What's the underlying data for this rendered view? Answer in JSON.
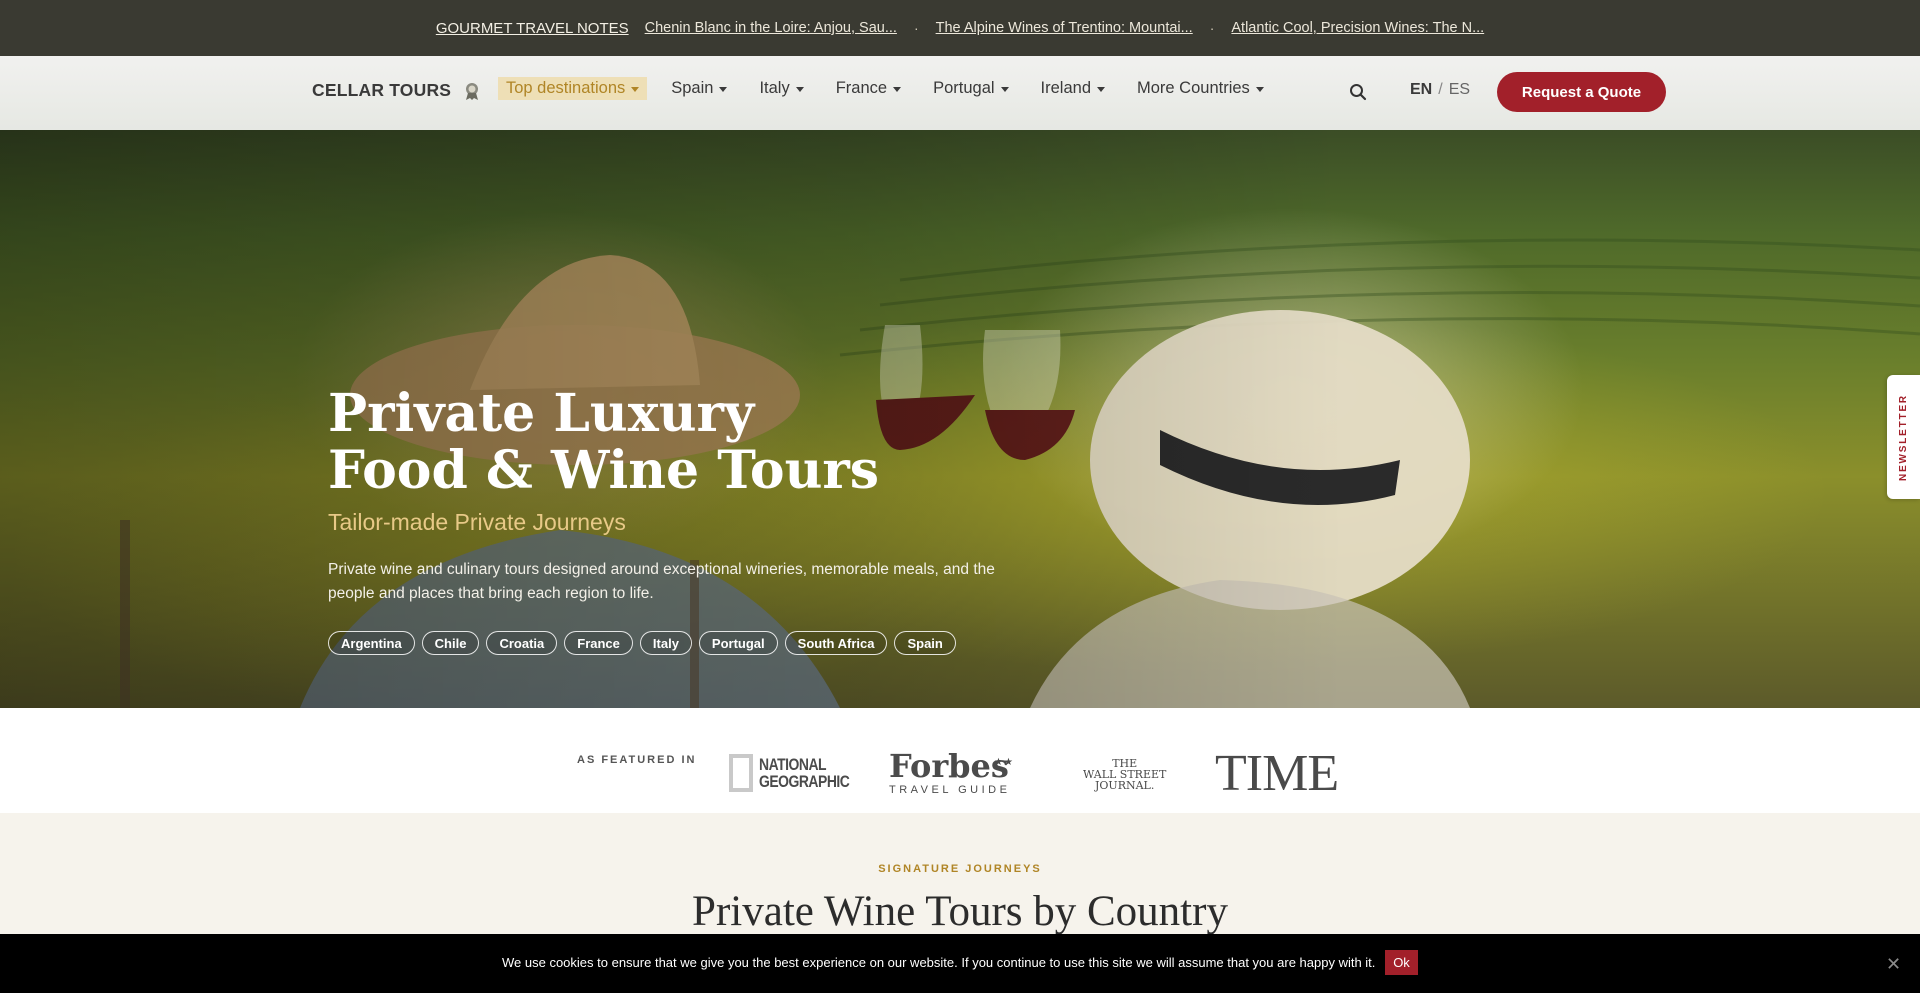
{
  "notes_bar": {
    "title": "GOURMET TRAVEL NOTES",
    "links": [
      "Chenin Blanc in the Loire: Anjou, Sau...",
      "The Alpine Wines of Trentino: Mountai...",
      "Atlantic Cool, Precision Wines: The N..."
    ],
    "separator": "·"
  },
  "nav": {
    "brand": "CELLAR TOURS",
    "award_icon": "award-badge-icon",
    "items": [
      {
        "label": "Top destinations",
        "highlighted": true
      },
      {
        "label": "Spain"
      },
      {
        "label": "Italy"
      },
      {
        "label": "France"
      },
      {
        "label": "Portugal"
      },
      {
        "label": "Ireland"
      },
      {
        "label": "More Countries"
      }
    ],
    "search_icon": "search-icon",
    "lang_en": "EN",
    "lang_sep": "/",
    "lang_es": "ES",
    "quote_button": "Request a Quote"
  },
  "hero": {
    "title_line1": "Private Luxury",
    "title_line2": "Food & Wine Tours",
    "subtitle": "Tailor-made Private Journeys",
    "description": "Private wine and culinary tours designed around exceptional wineries, memorable meals, and the people and places that bring each region to life.",
    "countries": [
      "Argentina",
      "Chile",
      "Croatia",
      "France",
      "Italy",
      "Portugal",
      "South Africa",
      "Spain"
    ]
  },
  "newsletter_tab": "NEWSLETTER",
  "featured": {
    "label": "AS FEATURED IN",
    "natgeo_line1": "NATIONAL",
    "natgeo_line2": "GEOGRAPHIC",
    "forbes_big": "Forbes",
    "forbes_stars": "★★",
    "forbes_small": "TRAVEL GUIDE",
    "wsj_line1": "THE",
    "wsj_line2": "WALL STREET",
    "wsj_line3": "JOURNAL.",
    "time": "TIME"
  },
  "signature": {
    "kicker": "SIGNATURE JOURNEYS",
    "heading": "Private Wine Tours by Country"
  },
  "cookie": {
    "message": "We use cookies to ensure that we give you the best experience on our website. If you continue to use this site we will assume that you are happy with it.",
    "ok": "Ok",
    "close": "✕"
  },
  "colors": {
    "notes_bar_bg": "#3a3a32",
    "accent_red": "#a2202a",
    "accent_gold": "#b08526",
    "highlight_bg": "#eedfb6",
    "subtitle_gold": "#e8c987"
  }
}
